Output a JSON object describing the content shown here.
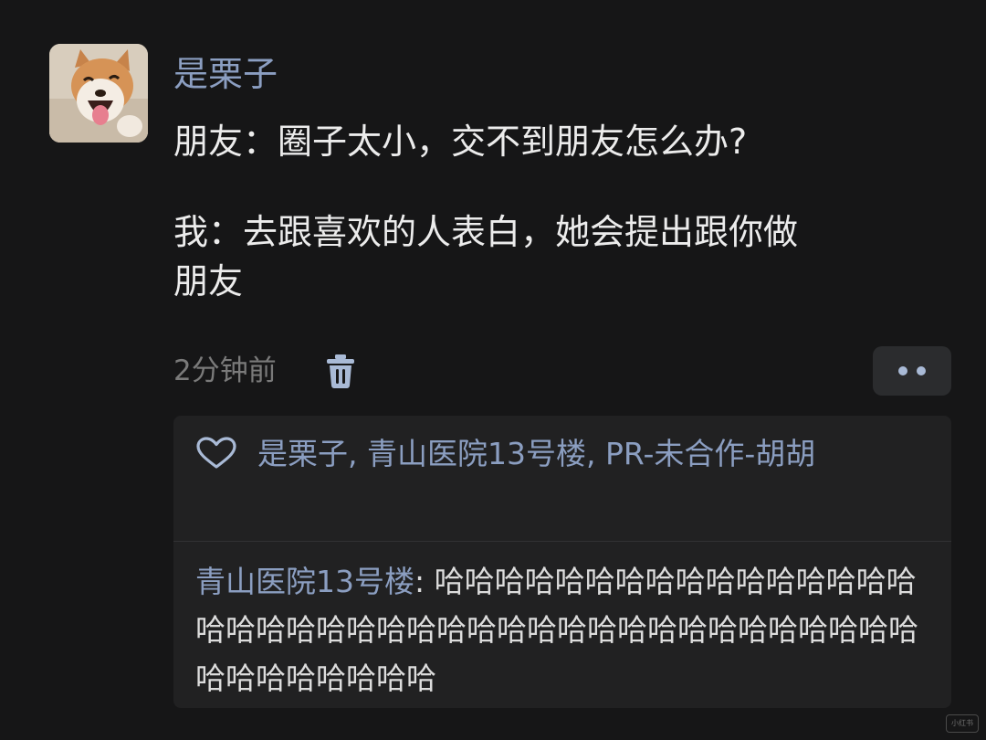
{
  "moment": {
    "author": "是栗子",
    "text_lines": [
      "朋友：圈子太小，交不到朋友怎么办?",
      "",
      "我：去跟喜欢的人表白，她会提出跟你做",
      "朋友"
    ],
    "time": "2分钟前",
    "trash_icon": "trash-icon",
    "more_icon": "more-dots-icon"
  },
  "likes": {
    "icon": "heart-icon",
    "names": "是栗子, 青山医院13号楼, PR-未合作-胡胡"
  },
  "comments": [
    {
      "author": "青山医院13号楼",
      "separator": ": ",
      "text": "哈哈哈哈哈哈哈哈哈哈哈哈哈哈哈哈哈哈哈哈哈哈哈哈哈哈哈哈哈哈哈哈哈哈哈哈哈哈哈哈哈哈哈哈哈哈哈哈"
    }
  ],
  "watermark": "小红书",
  "colors": {
    "background": "#161617",
    "panel": "#212122",
    "name_blue": "#8b9ec1",
    "text": "#ececec",
    "muted": "#7a7a7a"
  }
}
